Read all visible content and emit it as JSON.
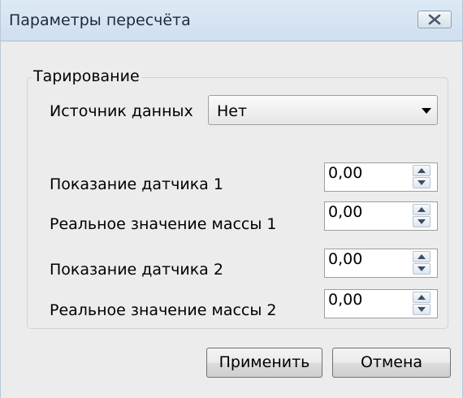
{
  "window": {
    "title": "Параметры пересчёта"
  },
  "group": {
    "title": "Тарирование"
  },
  "source": {
    "label": "Источник данных",
    "value": "Нет"
  },
  "fields": [
    {
      "label": "Показание датчика 1",
      "value": "0,00"
    },
    {
      "label": "Реальное значение массы 1",
      "value": "0,00"
    },
    {
      "label": "Показание датчика 2",
      "value": "0,00"
    },
    {
      "label": "Реальное значение массы 2",
      "value": "0,00"
    }
  ],
  "buttons": {
    "apply": "Применить",
    "cancel": "Отмена"
  },
  "icons": {
    "close": "close-icon",
    "dropdown": "chevron-down-icon",
    "spin_up": "arrow-up-icon",
    "spin_down": "arrow-down-icon"
  }
}
